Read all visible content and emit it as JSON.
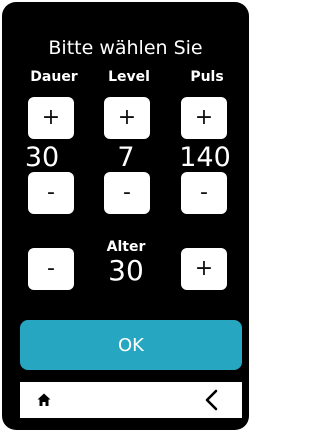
{
  "title": "Bitte wählen Sie",
  "columns": [
    {
      "label": "Dauer",
      "value": "30",
      "plus": "+",
      "minus": "-"
    },
    {
      "label": "Level",
      "value": "7",
      "plus": "+",
      "minus": "-"
    },
    {
      "label": "Puls",
      "value": "140",
      "plus": "+",
      "minus": "-"
    }
  ],
  "alter": {
    "label": "Alter",
    "value": "30",
    "minus": "-",
    "plus": "+"
  },
  "ok_label": "OK",
  "nav": {
    "home_icon": "home-icon",
    "back_icon": "chevron-left-icon"
  },
  "colors": {
    "background": "#000000",
    "button": "#ffffff",
    "accent": "#26a6c0"
  }
}
